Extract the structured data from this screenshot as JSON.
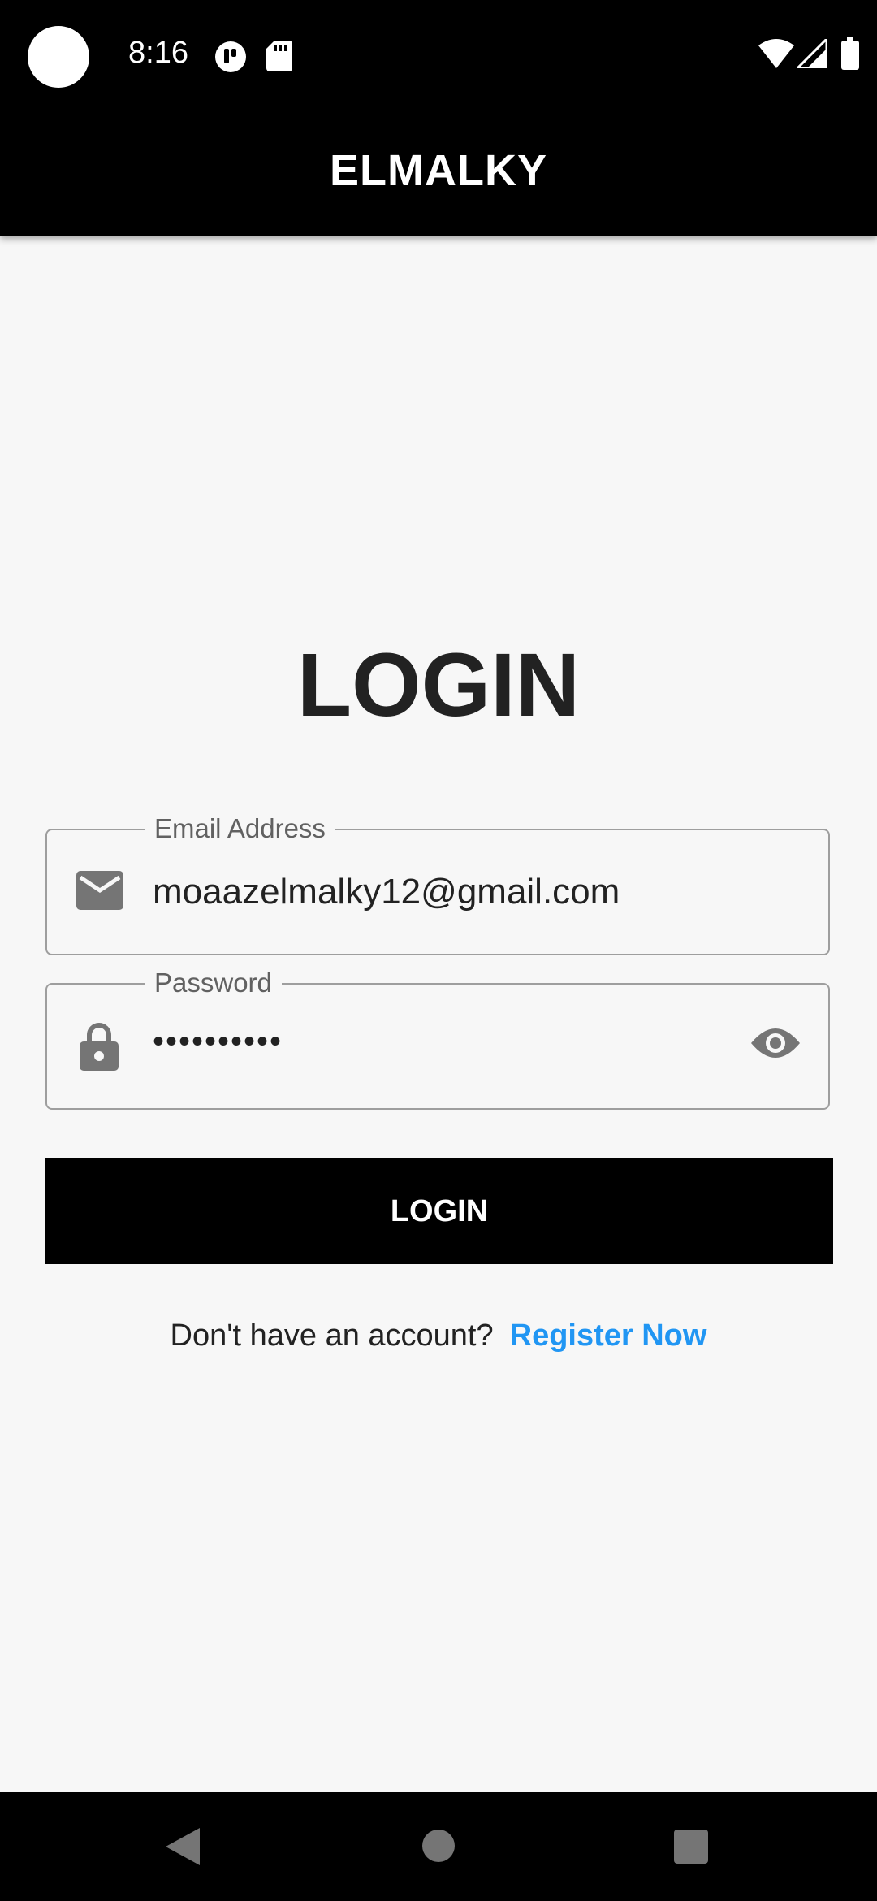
{
  "status_bar": {
    "time": "8:16",
    "icons": [
      "app-notification-icon",
      "sd-card-icon",
      "wifi-icon",
      "signal-icon",
      "battery-icon"
    ]
  },
  "app_bar": {
    "title": "ELMALKY"
  },
  "main": {
    "heading": "LOGIN",
    "email": {
      "label": "Email Address",
      "value": "moaazelmalky12@gmail.com",
      "icon": "email-icon"
    },
    "password": {
      "label": "Password",
      "value": "••••••••••",
      "icon": "lock-icon",
      "toggle_icon": "eye-icon"
    },
    "login_button": "LOGIN",
    "register_prompt": "Don't have an account?",
    "register_link": "Register Now"
  },
  "nav_bar": {
    "buttons": [
      "back-icon",
      "home-icon",
      "recents-icon"
    ]
  },
  "colors": {
    "background": "#f7f7f7",
    "app_bar": "#000000",
    "button": "#000000",
    "link": "#2196f3",
    "field_border": "#9e9e9e",
    "icon": "#757575"
  }
}
